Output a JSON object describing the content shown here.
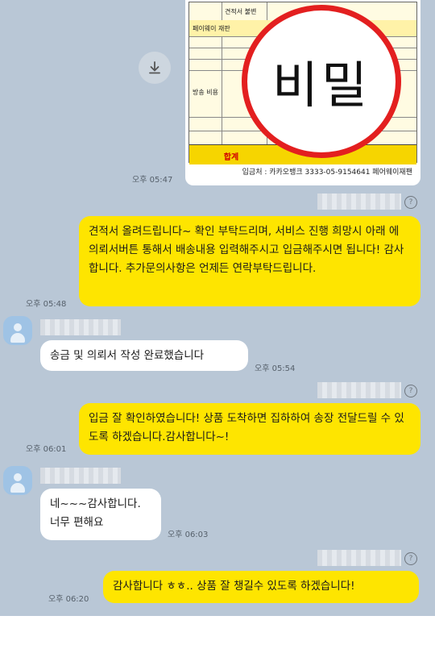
{
  "image": {
    "table_rows": [
      "견적서 불변",
      "페이웨이 재판",
      "방송 비용",
      "합계"
    ],
    "payinfo": "입금처 : 카카오뱅크 3333-05-9154641 페어웨이재팬",
    "stamp_text": "비밀"
  },
  "icons": {
    "download": "download-icon",
    "help": "question-icon",
    "avatar": "person-icon"
  },
  "messages": [
    {
      "time": "오후 05:47"
    },
    {
      "side": "right",
      "text": "견적서 올려드립니다~ 확인 부탁드리며, 서비스 진행 희망시 아래 에 의뢰서버튼 통해서 배송내용 입력해주시고 입금해주시면 됩니다! 감사합니다. 추가문의사항은 언제든 연락부탁드립니다.",
      "time": "오후 05:48"
    },
    {
      "side": "left",
      "text": "송금 및 의뢰서 작성 완료했습니다",
      "time": "오후 05:54"
    },
    {
      "side": "right",
      "text": "입금 잘 확인하였습니다! 상품 도착하면 집하하여 송장 전달드릴 수 있도록 하겠습니다.감사합니다~!",
      "time": "오후 06:01"
    },
    {
      "side": "left",
      "line1": "네~~~감사합니다.",
      "line2": "너무 편해요",
      "time": "오후 06:03"
    },
    {
      "side": "right",
      "text": "감사합니다 ㅎㅎ.. 상품 잘 챙길수 있도록 하겠습니다!",
      "time": "오후 06:20"
    }
  ],
  "colors": {
    "bg": "#b9c7d6",
    "mine": "#fee500",
    "theirs": "#ffffff",
    "stamp": "#e31f1f"
  }
}
